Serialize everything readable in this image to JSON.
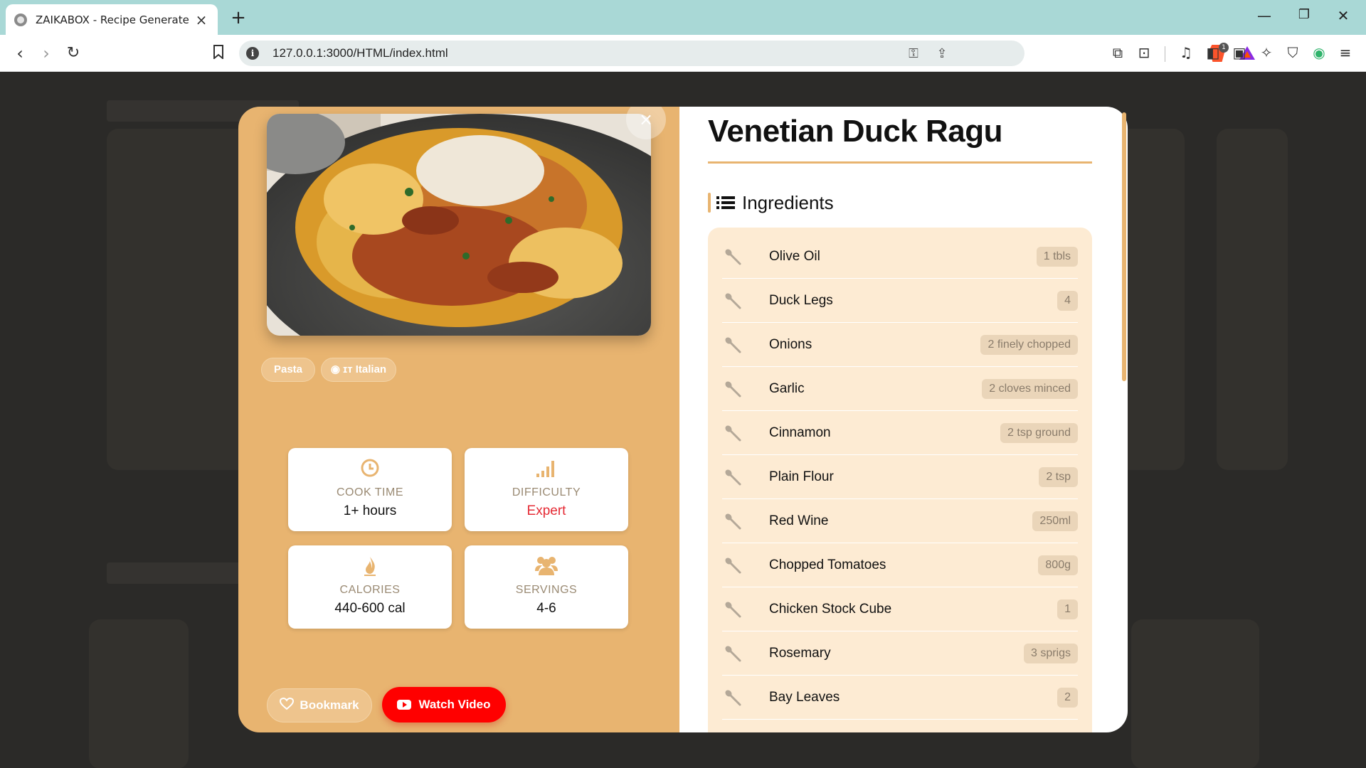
{
  "browser": {
    "tab_title": "ZAIKABOX - Recipe Generate",
    "new_tab": "+",
    "url": "127.0.0.1:3000/HTML/index.html",
    "brave_badge": "1",
    "window_controls": {
      "minimize": "—",
      "restore": "❐",
      "close": "✕"
    }
  },
  "modal": {
    "close_label": "×",
    "image_alt": "Venetian Duck Ragu",
    "tags": [
      {
        "label": "Pasta"
      },
      {
        "label": "Italian",
        "prefix": "ɪᴛ"
      }
    ],
    "stats": [
      {
        "label": "COOK TIME",
        "value": "1+ hours",
        "icon": "clock-icon"
      },
      {
        "label": "DIFFICULTY",
        "value": "Expert",
        "icon": "signal-bars-icon"
      },
      {
        "label": "CALORIES",
        "value": "440-600 cal",
        "icon": "flame-icon"
      },
      {
        "label": "SERVINGS",
        "value": "4-6",
        "icon": "users-icon"
      }
    ],
    "bookmark_label": "Bookmark",
    "video_label": "Watch Video",
    "title": "Venetian Duck Ragu",
    "ingredients_heading": "Ingredients",
    "ingredients": [
      {
        "name": "Olive Oil",
        "qty": "1 tbls"
      },
      {
        "name": "Duck Legs",
        "qty": "4"
      },
      {
        "name": "Onions",
        "qty": "2 finely chopped"
      },
      {
        "name": "Garlic",
        "qty": "2 cloves minced"
      },
      {
        "name": "Cinnamon",
        "qty": "2 tsp ground"
      },
      {
        "name": "Plain Flour",
        "qty": "2 tsp"
      },
      {
        "name": "Red Wine",
        "qty": "250ml"
      },
      {
        "name": "Chopped Tomatoes",
        "qty": "800g"
      },
      {
        "name": "Chicken Stock Cube",
        "qty": "1"
      },
      {
        "name": "Rosemary",
        "qty": "3 sprigs"
      },
      {
        "name": "Bay Leaves",
        "qty": "2"
      }
    ],
    "colors": {
      "accent": "#e8b470",
      "danger": "#e52b35",
      "youtube": "#ff0000",
      "ingredient_bg": "#fdebd3"
    }
  }
}
